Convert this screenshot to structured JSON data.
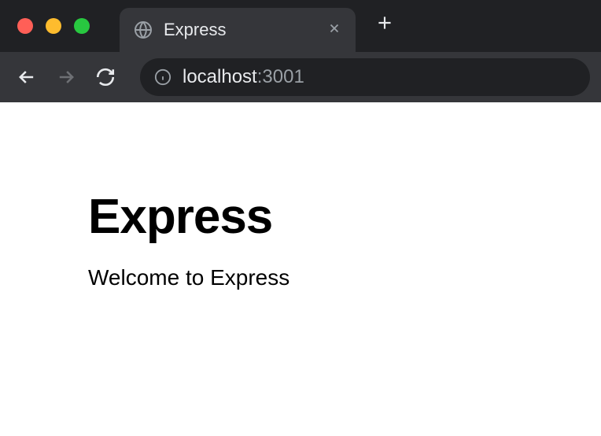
{
  "tab": {
    "title": "Express"
  },
  "address": {
    "host": "localhost",
    "port": ":3001"
  },
  "page": {
    "heading": "Express",
    "paragraph": "Welcome to Express"
  }
}
